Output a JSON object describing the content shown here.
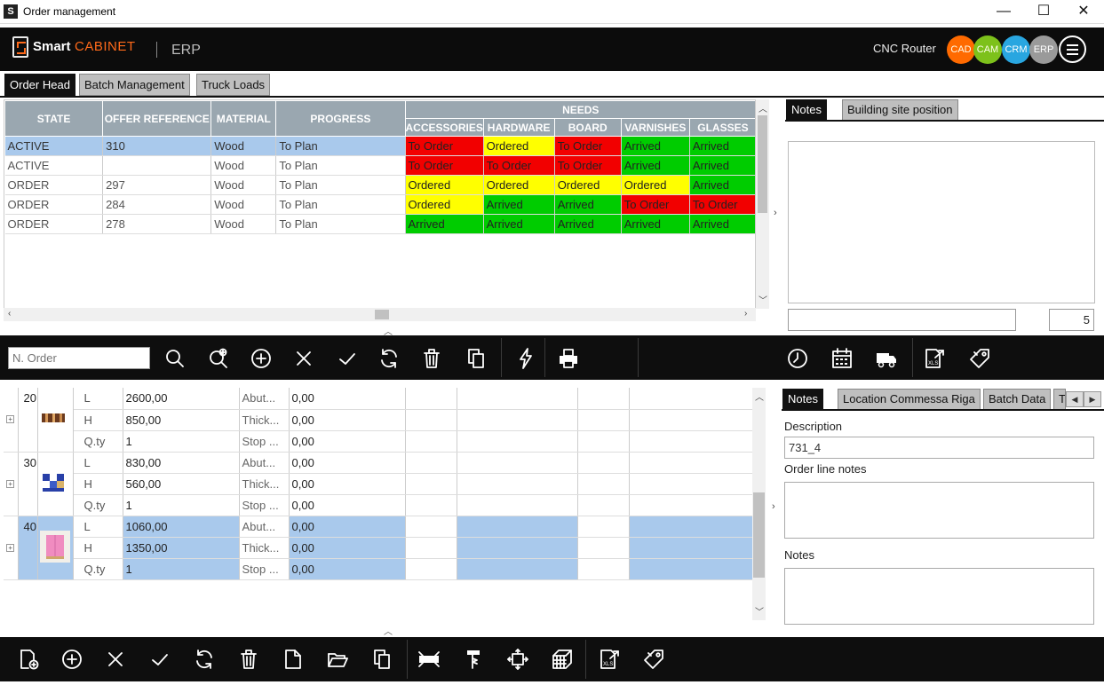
{
  "window": {
    "title": "Order management",
    "minimize": "—",
    "maximize": "☐",
    "close": "✕"
  },
  "header": {
    "logo_smart": "Smart",
    "logo_cabinet": "CABINET",
    "module": "ERP",
    "machine": "CNC Router",
    "modules": [
      {
        "label": "CAD",
        "color": "#ff6a00"
      },
      {
        "label": "CAM",
        "color": "#7dc11b"
      },
      {
        "label": "CRM",
        "color": "#29a6e0"
      },
      {
        "label": "ERP",
        "color": "#9a9a9a"
      }
    ]
  },
  "tabs": [
    "Order Head",
    "Batch Management",
    "Truck Loads"
  ],
  "order_table": {
    "headers": {
      "state": "STATE",
      "offer_reference": "OFFER REFERENCE",
      "material": "MATERIAL",
      "progress": "PROGRESS",
      "needs": "NEEDS",
      "accessories": "ACCESSORIES",
      "hardware": "HARDWARE",
      "board": "BOARD",
      "varnishes": "VARNISHES",
      "glasses": "GLASSES"
    },
    "rows": [
      {
        "state": "ACTIVE",
        "ref": "310",
        "material": "Wood",
        "progress": "To Plan",
        "needs": [
          "To Order",
          "Ordered",
          "To Order",
          "Arrived",
          "Arrived"
        ]
      },
      {
        "state": "ACTIVE",
        "ref": "",
        "material": "Wood",
        "progress": "To Plan",
        "needs": [
          "To Order",
          "To Order",
          "To Order",
          "Arrived",
          "Arrived"
        ]
      },
      {
        "state": "ORDER",
        "ref": "297",
        "material": "Wood",
        "progress": "To Plan",
        "needs": [
          "Ordered",
          "Ordered",
          "Ordered",
          "Ordered",
          "Arrived"
        ]
      },
      {
        "state": "ORDER",
        "ref": "284",
        "material": "Wood",
        "progress": "To Plan",
        "needs": [
          "Ordered",
          "Arrived",
          "Arrived",
          "To Order",
          "To Order"
        ]
      },
      {
        "state": "ORDER",
        "ref": "278",
        "material": "Wood",
        "progress": "To Plan",
        "needs": [
          "Arrived",
          "Arrived",
          "Arrived",
          "Arrived",
          "Arrived"
        ]
      }
    ],
    "status_colors": {
      "To Order": "#f20000",
      "Ordered": "#ffff00",
      "Arrived": "#00cc00"
    }
  },
  "search": {
    "placeholder": "N. Order"
  },
  "upper_notes": {
    "tabs": [
      "Notes",
      "Building site position"
    ],
    "count": "5"
  },
  "order_lines": [
    {
      "num": "20",
      "thumb": "wood-panel",
      "L": "2600,00",
      "H": "850,00",
      "Qty": "1",
      "p1": "Abut...",
      "p2": "Thick...",
      "p3": "Stop ...",
      "v1": "0,00",
      "v2": "0,00",
      "v3": "0,00"
    },
    {
      "num": "30",
      "thumb": "blue-panel",
      "L": "830,00",
      "H": "560,00",
      "Qty": "1",
      "p1": "Abut...",
      "p2": "Thick...",
      "p3": "Stop ...",
      "v1": "0,00",
      "v2": "0,00",
      "v3": "0,00"
    },
    {
      "num": "40",
      "thumb": "pink-cabinet",
      "L": "1060,00",
      "H": "1350,00",
      "Qty": "1",
      "p1": "Abut...",
      "p2": "Thick...",
      "p3": "Stop ...",
      "v1": "0,00",
      "v2": "0,00",
      "v3": "0,00"
    }
  ],
  "line_labels": {
    "L": "L",
    "H": "H",
    "Qty": "Q.ty"
  },
  "lower_panel": {
    "tabs": [
      "Notes",
      "Location Commessa Riga",
      "Batch Data",
      "T"
    ],
    "description_label": "Description",
    "description_value": "731_4",
    "line_notes_label": "Order line notes",
    "notes_label": "Notes"
  }
}
